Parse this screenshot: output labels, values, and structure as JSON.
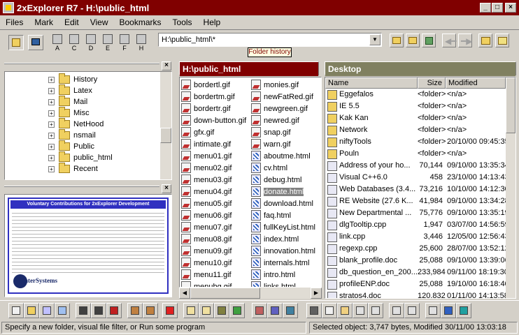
{
  "window": {
    "title": "2xExplorer R7 - H:\\public_html"
  },
  "menu": [
    "Files",
    "Mark",
    "Edit",
    "View",
    "Bookmarks",
    "Tools",
    "Help"
  ],
  "drives": [
    "A",
    "C",
    "D",
    "E",
    "F",
    "H"
  ],
  "path_input": {
    "value": "H:\\public_html\\*"
  },
  "tooltip": "Folder history",
  "tree": [
    "History",
    "Latex",
    "Mail",
    "Misc",
    "NetHood",
    "nsmail",
    "Public",
    "public_html",
    "Recent"
  ],
  "preview": {
    "title": "Voluntary Contributions for 2xExplorer Development",
    "logo_text": "nterSystems"
  },
  "left_pane": {
    "header": "H:\\public_html",
    "col1": [
      "bordertl.gif",
      "bordertm.gif",
      "bordertr.gif",
      "down-button.gif",
      "gfx.gif",
      "intimate.gif",
      "menu01.gif",
      "menu02.gif",
      "menu03.gif",
      "menu04.gif",
      "menu05.gif",
      "menu06.gif",
      "menu07.gif",
      "menu08.gif",
      "menu09.gif",
      "menu10.gif",
      "menu11.gif",
      "menubg.gif"
    ],
    "col2": [
      "monies.gif",
      "newFatRed.gif",
      "newgreen.gif",
      "newred.gif",
      "snap.gif",
      "warn.gif",
      "aboutme.html",
      "cv.html",
      "debug.html",
      "donate.html",
      "download.html",
      "faq.html",
      "fullKeyList.html",
      "index.html",
      "innovation.html",
      "internals.html",
      "intro.html",
      "links.html"
    ],
    "selected": "donate.html"
  },
  "right_pane": {
    "header": "Desktop",
    "columns": [
      "Name",
      "Size",
      "Modified"
    ],
    "rows": [
      {
        "name": "Eggefalos",
        "size": "<folder>",
        "mod": "<n/a>"
      },
      {
        "name": "IE 5.5",
        "size": "<folder>",
        "mod": "<n/a>"
      },
      {
        "name": "Kak Kan",
        "size": "<folder>",
        "mod": "<n/a>"
      },
      {
        "name": "Network",
        "size": "<folder>",
        "mod": "<n/a>"
      },
      {
        "name": "niftyTools",
        "size": "<folder>",
        "mod": "20/10/00 09:45:35"
      },
      {
        "name": "Pouln",
        "size": "<folder>",
        "mod": "<n/a>"
      },
      {
        "name": "Address of your ho...",
        "size": "70,144",
        "mod": "09/10/00 13:35:34"
      },
      {
        "name": "Visual C++6.0",
        "size": "458",
        "mod": "23/10/00 14:13:43"
      },
      {
        "name": "Web Databases (3.4...",
        "size": "73,216",
        "mod": "10/10/00 14:12:30"
      },
      {
        "name": "RE Website (27.6 K...",
        "size": "41,984",
        "mod": "09/10/00 13:34:28"
      },
      {
        "name": "New Departmental ...",
        "size": "75,776",
        "mod": "09/10/00 13:35:19"
      },
      {
        "name": "dlgTooltip.cpp",
        "size": "1,947",
        "mod": "03/07/00 14:56:59"
      },
      {
        "name": "link.cpp",
        "size": "3,446",
        "mod": "12/05/00 12:56:43"
      },
      {
        "name": "regexp.cpp",
        "size": "25,600",
        "mod": "28/07/00 13:52:12"
      },
      {
        "name": "blank_profile.doc",
        "size": "25,088",
        "mod": "09/10/00 13:39:06"
      },
      {
        "name": "db_question_en_200...",
        "size": "233,984",
        "mod": "09/11/00 18:19:30"
      },
      {
        "name": "profileENP.doc",
        "size": "25,088",
        "mod": "19/10/00 16:18:40"
      },
      {
        "name": "stratos4.doc",
        "size": "120,832",
        "mod": "01/11/00 14:13:58"
      }
    ]
  },
  "status": {
    "left": "Specify a new folder, visual file filter, or Run some program",
    "right": "Selected object: 3,747 bytes, Modified 30/11/00 13:03:18"
  }
}
